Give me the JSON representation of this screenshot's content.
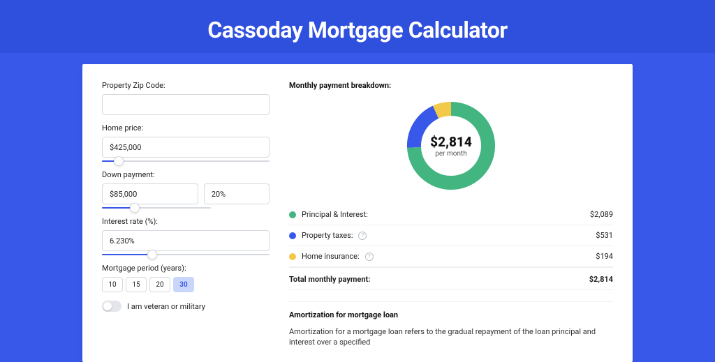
{
  "page": {
    "title": "Cassoday Mortgage Calculator"
  },
  "form": {
    "zip": {
      "label": "Property Zip Code:",
      "value": ""
    },
    "home_price": {
      "label": "Home price:",
      "value": "$425,000",
      "slider_pct": 10
    },
    "down": {
      "label": "Down payment:",
      "amount": "$85,000",
      "percent": "20%",
      "slider_pct": 20
    },
    "rate": {
      "label": "Interest rate (%):",
      "value": "6.230%",
      "slider_pct": 30
    },
    "period": {
      "label": "Mortgage period (years):",
      "options": [
        "10",
        "15",
        "20",
        "30"
      ],
      "active_index": 3
    },
    "veteran": {
      "label": "I am veteran or military",
      "checked": false
    }
  },
  "breakdown": {
    "title": "Monthly payment breakdown:",
    "center_amount": "$2,814",
    "center_sub": "per month",
    "items": [
      {
        "label": "Principal & Interest:",
        "value": "$2,089",
        "color": "#43b581",
        "help": false
      },
      {
        "label": "Property taxes:",
        "value": "$531",
        "color": "#3858e9",
        "help": true
      },
      {
        "label": "Home insurance:",
        "value": "$194",
        "color": "#f3c94a",
        "help": true
      }
    ],
    "total_label": "Total monthly payment:",
    "total_value": "$2,814"
  },
  "amort": {
    "title": "Amortization for mortgage loan",
    "text": "Amortization for a mortgage loan refers to the gradual repayment of the loan principal and interest over a specified"
  },
  "chart_data": {
    "type": "pie",
    "title": "Monthly payment breakdown",
    "series": [
      {
        "name": "Principal & Interest",
        "values": [
          2089
        ],
        "color": "#43b581"
      },
      {
        "name": "Property taxes",
        "values": [
          531
        ],
        "color": "#3858e9"
      },
      {
        "name": "Home insurance",
        "values": [
          194
        ],
        "color": "#f3c94a"
      }
    ],
    "total": 2814,
    "center_label": "$2,814 per month"
  }
}
